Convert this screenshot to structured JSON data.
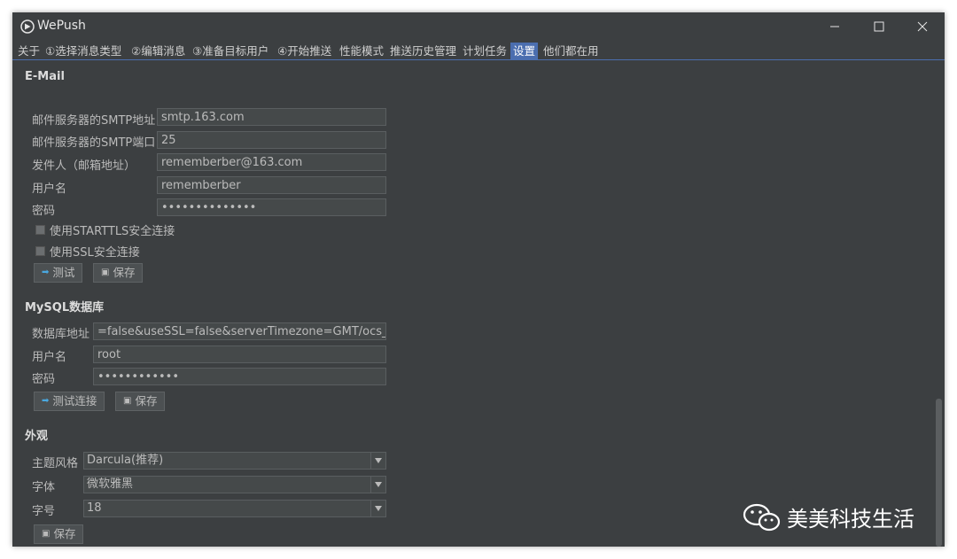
{
  "window": {
    "title": "WePush"
  },
  "tabs": [
    {
      "label": "关于"
    },
    {
      "label": "①选择消息类型"
    },
    {
      "label": "②编辑消息"
    },
    {
      "label": "③准备目标用户"
    },
    {
      "label": "④开始推送"
    },
    {
      "label": "性能模式"
    },
    {
      "label": "推送历史管理"
    },
    {
      "label": "计划任务"
    },
    {
      "label": "设置",
      "active": true
    },
    {
      "label": "他们都在用"
    }
  ],
  "email": {
    "title": "E-Mail",
    "smtp_host_label": "邮件服务器的SMTP地址",
    "smtp_host": "smtp.163.com",
    "smtp_port_label": "邮件服务器的SMTP端口",
    "smtp_port": "25",
    "from_label": "发件人（邮箱地址）",
    "from": "rememberber@163.com",
    "user_label": "用户名",
    "user": "rememberber",
    "password_label": "密码",
    "password": "••••••••••••••",
    "starttls_label": "使用STARTTLS安全连接",
    "ssl_label": "使用SSL安全连接",
    "test_label": "测试",
    "save_label": "保存"
  },
  "mysql": {
    "title": "MySQL数据库",
    "url_label": "数据库地址",
    "url": "=false&useSSL=false&serverTimezone=GMT/ocs_test",
    "user_label": "用户名",
    "user": "root",
    "password_label": "密码",
    "password": "••••••••••••",
    "test_label": "测试连接",
    "save_label": "保存"
  },
  "appearance": {
    "title": "外观",
    "theme_label": "主题风格",
    "theme": "Darcula(推荐)",
    "font_label": "字体",
    "font": "微软雅黑",
    "size_label": "字号",
    "size": "18",
    "save_label": "保存"
  },
  "watermark": {
    "text": "美美科技生活"
  },
  "colors": {
    "background": "#3c3f41",
    "accent": "#4b6eaf",
    "field": "#45494a",
    "test_icon": "#4aa8e0"
  }
}
